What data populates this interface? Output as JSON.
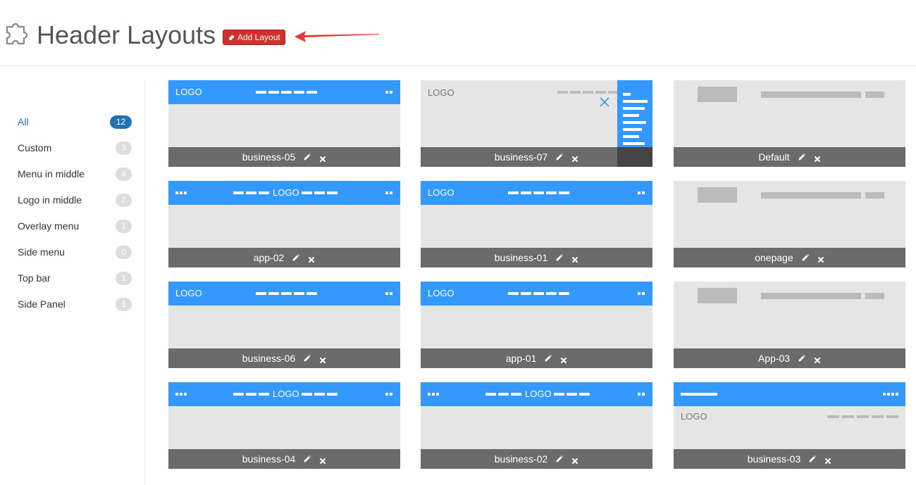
{
  "page": {
    "title": "Header Layouts",
    "add_button_label": "Add Layout"
  },
  "icons": {
    "title_icon": "puzzle-icon",
    "add_icon": "link-icon",
    "edit_icon": "pencil-icon",
    "delete_icon": "close-icon",
    "annotation": "red-arrow"
  },
  "colors": {
    "accent": "#2271b1",
    "button": "#d0312a",
    "header_preview": "#3399ff",
    "card_footer": "#6b6b6b",
    "card_body": "#e5e5e5",
    "arrow": "#e53935"
  },
  "sidebar": {
    "items": [
      {
        "label": "All",
        "count": "12",
        "active": true
      },
      {
        "label": "Custom",
        "count": "3"
      },
      {
        "label": "Menu in middle",
        "count": "4"
      },
      {
        "label": "Logo in middle",
        "count": "2"
      },
      {
        "label": "Overlay menu",
        "count": "1"
      },
      {
        "label": "Side menu",
        "count": "0"
      },
      {
        "label": "Top bar",
        "count": "1"
      },
      {
        "label": "Side Panel",
        "count": "1"
      }
    ]
  },
  "preview_text": {
    "logo": "LOGO"
  },
  "layouts": [
    {
      "name": "business-05",
      "style": "logo-left"
    },
    {
      "name": "business-07",
      "style": "side-panel"
    },
    {
      "name": "Default",
      "style": "default"
    },
    {
      "name": "app-02",
      "style": "logo-middle"
    },
    {
      "name": "business-01",
      "style": "logo-left"
    },
    {
      "name": "onepage",
      "style": "default"
    },
    {
      "name": "business-06",
      "style": "logo-left"
    },
    {
      "name": "app-01",
      "style": "logo-left"
    },
    {
      "name": "App-03",
      "style": "default"
    },
    {
      "name": "business-04",
      "style": "logo-middle"
    },
    {
      "name": "business-02",
      "style": "logo-middle"
    },
    {
      "name": "business-03",
      "style": "top-bar"
    }
  ]
}
